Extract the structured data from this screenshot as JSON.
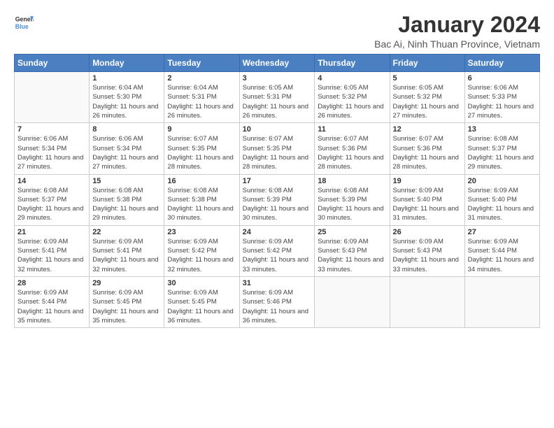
{
  "header": {
    "logo_line1": "General",
    "logo_line2": "Blue",
    "month_title": "January 2024",
    "subtitle": "Bac Ai, Ninh Thuan Province, Vietnam"
  },
  "weekdays": [
    "Sunday",
    "Monday",
    "Tuesday",
    "Wednesday",
    "Thursday",
    "Friday",
    "Saturday"
  ],
  "weeks": [
    [
      {
        "day": "",
        "sunrise": "",
        "sunset": "",
        "daylight": ""
      },
      {
        "day": "1",
        "sunrise": "Sunrise: 6:04 AM",
        "sunset": "Sunset: 5:30 PM",
        "daylight": "Daylight: 11 hours and 26 minutes."
      },
      {
        "day": "2",
        "sunrise": "Sunrise: 6:04 AM",
        "sunset": "Sunset: 5:31 PM",
        "daylight": "Daylight: 11 hours and 26 minutes."
      },
      {
        "day": "3",
        "sunrise": "Sunrise: 6:05 AM",
        "sunset": "Sunset: 5:31 PM",
        "daylight": "Daylight: 11 hours and 26 minutes."
      },
      {
        "day": "4",
        "sunrise": "Sunrise: 6:05 AM",
        "sunset": "Sunset: 5:32 PM",
        "daylight": "Daylight: 11 hours and 26 minutes."
      },
      {
        "day": "5",
        "sunrise": "Sunrise: 6:05 AM",
        "sunset": "Sunset: 5:32 PM",
        "daylight": "Daylight: 11 hours and 27 minutes."
      },
      {
        "day": "6",
        "sunrise": "Sunrise: 6:06 AM",
        "sunset": "Sunset: 5:33 PM",
        "daylight": "Daylight: 11 hours and 27 minutes."
      }
    ],
    [
      {
        "day": "7",
        "sunrise": "Sunrise: 6:06 AM",
        "sunset": "Sunset: 5:34 PM",
        "daylight": "Daylight: 11 hours and 27 minutes."
      },
      {
        "day": "8",
        "sunrise": "Sunrise: 6:06 AM",
        "sunset": "Sunset: 5:34 PM",
        "daylight": "Daylight: 11 hours and 27 minutes."
      },
      {
        "day": "9",
        "sunrise": "Sunrise: 6:07 AM",
        "sunset": "Sunset: 5:35 PM",
        "daylight": "Daylight: 11 hours and 28 minutes."
      },
      {
        "day": "10",
        "sunrise": "Sunrise: 6:07 AM",
        "sunset": "Sunset: 5:35 PM",
        "daylight": "Daylight: 11 hours and 28 minutes."
      },
      {
        "day": "11",
        "sunrise": "Sunrise: 6:07 AM",
        "sunset": "Sunset: 5:36 PM",
        "daylight": "Daylight: 11 hours and 28 minutes."
      },
      {
        "day": "12",
        "sunrise": "Sunrise: 6:07 AM",
        "sunset": "Sunset: 5:36 PM",
        "daylight": "Daylight: 11 hours and 28 minutes."
      },
      {
        "day": "13",
        "sunrise": "Sunrise: 6:08 AM",
        "sunset": "Sunset: 5:37 PM",
        "daylight": "Daylight: 11 hours and 29 minutes."
      }
    ],
    [
      {
        "day": "14",
        "sunrise": "Sunrise: 6:08 AM",
        "sunset": "Sunset: 5:37 PM",
        "daylight": "Daylight: 11 hours and 29 minutes."
      },
      {
        "day": "15",
        "sunrise": "Sunrise: 6:08 AM",
        "sunset": "Sunset: 5:38 PM",
        "daylight": "Daylight: 11 hours and 29 minutes."
      },
      {
        "day": "16",
        "sunrise": "Sunrise: 6:08 AM",
        "sunset": "Sunset: 5:38 PM",
        "daylight": "Daylight: 11 hours and 30 minutes."
      },
      {
        "day": "17",
        "sunrise": "Sunrise: 6:08 AM",
        "sunset": "Sunset: 5:39 PM",
        "daylight": "Daylight: 11 hours and 30 minutes."
      },
      {
        "day": "18",
        "sunrise": "Sunrise: 6:08 AM",
        "sunset": "Sunset: 5:39 PM",
        "daylight": "Daylight: 11 hours and 30 minutes."
      },
      {
        "day": "19",
        "sunrise": "Sunrise: 6:09 AM",
        "sunset": "Sunset: 5:40 PM",
        "daylight": "Daylight: 11 hours and 31 minutes."
      },
      {
        "day": "20",
        "sunrise": "Sunrise: 6:09 AM",
        "sunset": "Sunset: 5:40 PM",
        "daylight": "Daylight: 11 hours and 31 minutes."
      }
    ],
    [
      {
        "day": "21",
        "sunrise": "Sunrise: 6:09 AM",
        "sunset": "Sunset: 5:41 PM",
        "daylight": "Daylight: 11 hours and 32 minutes."
      },
      {
        "day": "22",
        "sunrise": "Sunrise: 6:09 AM",
        "sunset": "Sunset: 5:41 PM",
        "daylight": "Daylight: 11 hours and 32 minutes."
      },
      {
        "day": "23",
        "sunrise": "Sunrise: 6:09 AM",
        "sunset": "Sunset: 5:42 PM",
        "daylight": "Daylight: 11 hours and 32 minutes."
      },
      {
        "day": "24",
        "sunrise": "Sunrise: 6:09 AM",
        "sunset": "Sunset: 5:42 PM",
        "daylight": "Daylight: 11 hours and 33 minutes."
      },
      {
        "day": "25",
        "sunrise": "Sunrise: 6:09 AM",
        "sunset": "Sunset: 5:43 PM",
        "daylight": "Daylight: 11 hours and 33 minutes."
      },
      {
        "day": "26",
        "sunrise": "Sunrise: 6:09 AM",
        "sunset": "Sunset: 5:43 PM",
        "daylight": "Daylight: 11 hours and 33 minutes."
      },
      {
        "day": "27",
        "sunrise": "Sunrise: 6:09 AM",
        "sunset": "Sunset: 5:44 PM",
        "daylight": "Daylight: 11 hours and 34 minutes."
      }
    ],
    [
      {
        "day": "28",
        "sunrise": "Sunrise: 6:09 AM",
        "sunset": "Sunset: 5:44 PM",
        "daylight": "Daylight: 11 hours and 35 minutes."
      },
      {
        "day": "29",
        "sunrise": "Sunrise: 6:09 AM",
        "sunset": "Sunset: 5:45 PM",
        "daylight": "Daylight: 11 hours and 35 minutes."
      },
      {
        "day": "30",
        "sunrise": "Sunrise: 6:09 AM",
        "sunset": "Sunset: 5:45 PM",
        "daylight": "Daylight: 11 hours and 36 minutes."
      },
      {
        "day": "31",
        "sunrise": "Sunrise: 6:09 AM",
        "sunset": "Sunset: 5:46 PM",
        "daylight": "Daylight: 11 hours and 36 minutes."
      },
      {
        "day": "",
        "sunrise": "",
        "sunset": "",
        "daylight": ""
      },
      {
        "day": "",
        "sunrise": "",
        "sunset": "",
        "daylight": ""
      },
      {
        "day": "",
        "sunrise": "",
        "sunset": "",
        "daylight": ""
      }
    ]
  ]
}
